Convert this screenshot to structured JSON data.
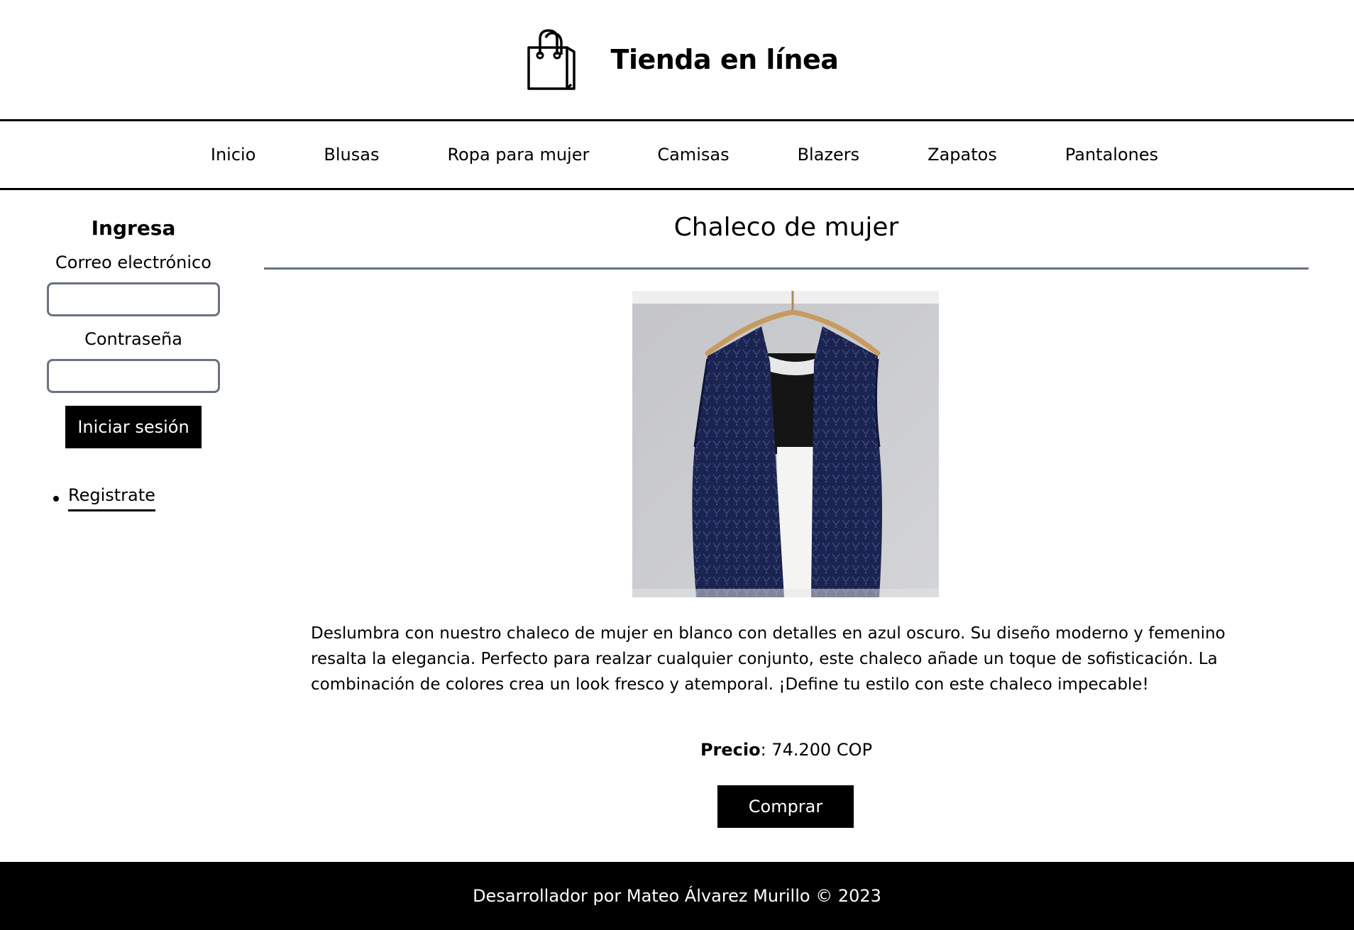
{
  "header": {
    "logo_icon": "shopping-bag-icon",
    "title": "Tienda en línea"
  },
  "nav": {
    "items": [
      {
        "label": "Inicio"
      },
      {
        "label": "Blusas"
      },
      {
        "label": "Ropa para mujer"
      },
      {
        "label": "Camisas"
      },
      {
        "label": "Blazers"
      },
      {
        "label": "Zapatos"
      },
      {
        "label": "Pantalones"
      }
    ]
  },
  "sidebar": {
    "title": "Ingresa",
    "email_label": "Correo electrónico",
    "email_value": "",
    "password_label": "Contraseña",
    "password_value": "",
    "login_button": "Iniciar sesión",
    "register_link": "Registrate"
  },
  "product": {
    "title": "Chaleco de mujer",
    "description": "Deslumbra con nuestro chaleco de mujer en blanco con detalles en azul oscuro. Su diseño moderno y femenino resalta la elegancia. Perfecto para realzar cualquier conjunto, este chaleco añade un toque de sofisticación. La combinación de colores crea un look fresco y atemporal. ¡Define tu estilo con este chaleco impecable!",
    "price_label": "Precio",
    "price_value": ": 74.200 COP",
    "buy_button": "Comprar"
  },
  "footer": {
    "text": "Desarrollador por Mateo Álvarez Murillo © 2023"
  },
  "colors": {
    "primary": "#000000",
    "rule": "#6b7280",
    "input_border": "#6b7280",
    "vest": "#1b2450"
  }
}
